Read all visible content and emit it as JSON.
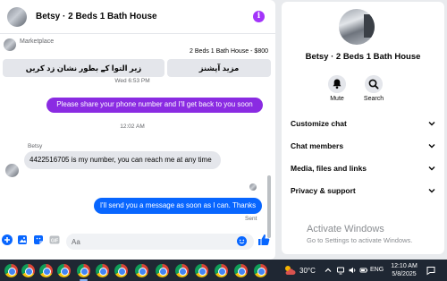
{
  "chat": {
    "title": "Betsy · 2 Beds 1 Bath House",
    "info_icon": "info-icon",
    "marketplace": {
      "label": "Marketplace",
      "listing": "2 Beds 1 Bath House - $800",
      "button_1": "زیر التوا کے بطور نشان زد کریں",
      "button_2": "مزید آپشنز"
    },
    "messages": {
      "timestamp_1": "Wed 6:53 PM",
      "outgoing_1": "Please share your phone number and I'll get back to you soon",
      "timestamp_2": "12:02 AM",
      "sender": "Betsy",
      "incoming_1": "4422516705 is my number, you can reach me at any time",
      "outgoing_2": "I'll send you a message as soon as I can. Thanks",
      "status": "Sent"
    },
    "composer": {
      "placeholder": "Aa",
      "icons": [
        "plus-icon",
        "image-icon",
        "sticker-icon",
        "gif-icon",
        "emoji-icon",
        "like-icon"
      ],
      "gif_label": "GIF"
    },
    "colors": {
      "outgoing_1": "#8a2be2",
      "outgoing_2": "#0866ff",
      "accent": "#0866ff",
      "info": "#a334fa"
    }
  },
  "info_panel": {
    "name": "Betsy · 2 Beds 1 Bath House",
    "actions": [
      {
        "label": "Mute",
        "icon": "bell-icon"
      },
      {
        "label": "Search",
        "icon": "search-icon"
      }
    ],
    "sections": [
      "Customize chat",
      "Chat members",
      "Media, files and links",
      "Privacy & support"
    ]
  },
  "watermark": {
    "line1": "Activate Windows",
    "line2": "Go to Settings to activate Windows."
  },
  "taskbar": {
    "app_icon": "chrome-icon",
    "weather": "30°C",
    "language": "ENG",
    "time": "12:10 AM",
    "date": "5/8/2025"
  }
}
